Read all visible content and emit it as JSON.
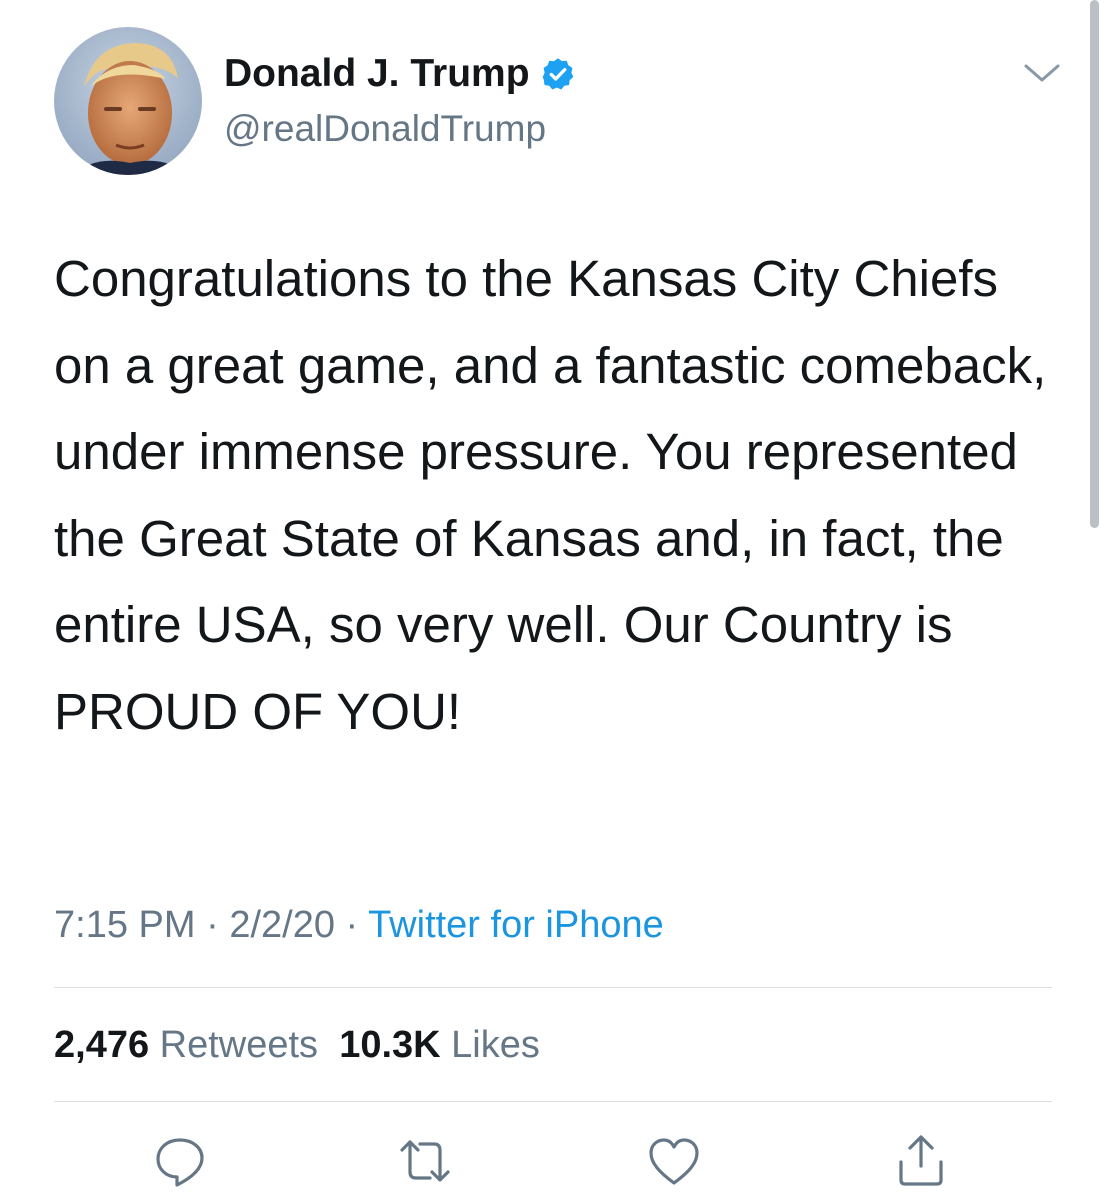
{
  "user": {
    "display_name": "Donald J. Trump",
    "handle": "@realDonaldTrump",
    "verified": true,
    "verified_color": "#1da1f2"
  },
  "tweet": {
    "text": "Congratulations to the Kansas City Chiefs on a great game, and a fantastic comeback, under immense pressure. You represented the Great State of Kansas and, in fact, the entire USA, so very well. Our Country is PROUD OF YOU!",
    "time": "7:15 PM",
    "separator": " · ",
    "date": "2/2/20",
    "source": "Twitter for iPhone"
  },
  "stats": {
    "retweets_count": "2,476",
    "retweets_label": "Retweets",
    "likes_count": "10.3K",
    "likes_label": "Likes"
  },
  "actions": {
    "icons": [
      "reply-icon",
      "retweet-icon",
      "like-icon",
      "share-icon"
    ]
  },
  "colors": {
    "text": "#14171a",
    "secondary": "#657786",
    "link": "#1b95e0",
    "divider": "#d9dee2"
  }
}
